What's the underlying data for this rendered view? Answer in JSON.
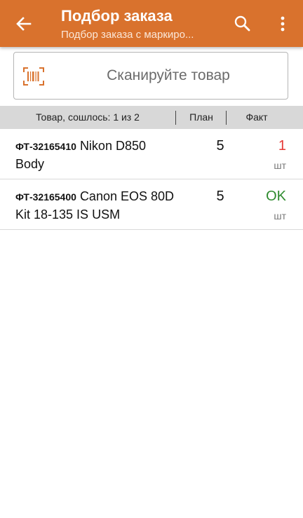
{
  "header": {
    "title": "Подбор заказа",
    "subtitle": "Подбор заказа с маркиро...",
    "back_icon": "arrow-left-icon",
    "search_icon": "search-icon",
    "menu_icon": "more-vert-icon",
    "bg_color": "#d9722d"
  },
  "scan": {
    "label": "Сканируйте товар",
    "icon": "barcode-scan-icon",
    "icon_color": "#d9722d"
  },
  "table": {
    "col_product": "Товар, сошлось: 1 из 2",
    "col_plan": "План",
    "col_fact": "Факт"
  },
  "rows": [
    {
      "code": "ФТ-32165410",
      "name": "Nikon D850 Body",
      "plan": "5",
      "fact": "1",
      "fact_color": "#e53935",
      "unit": "шт"
    },
    {
      "code": "ФТ-32165400",
      "name": "Canon EOS 80D Kit 18-135 IS USM",
      "plan": "5",
      "fact": "OK",
      "fact_color": "#2e8b2e",
      "unit": "шт"
    }
  ]
}
